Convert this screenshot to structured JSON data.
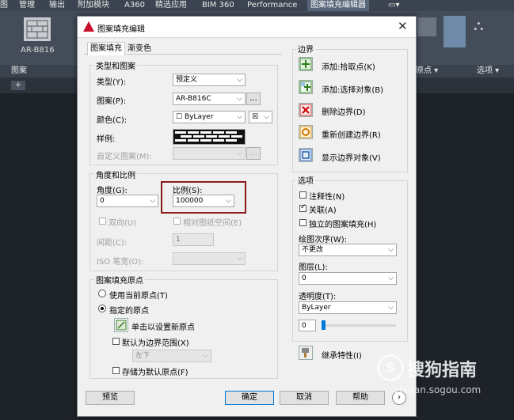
{
  "ribbon": {
    "menu": [
      "图",
      "管理",
      "输出",
      "附加模块",
      "A360",
      "精选应用",
      "BIM 360",
      "Performance",
      "图案填充编辑器"
    ],
    "pattern_label": "AR-B816",
    "panel_left": "图案",
    "panel_boundary_point": "原点",
    "panel_options": "选项"
  },
  "dialog": {
    "title": "图案填充编辑",
    "tabs": [
      "图案填充",
      "渐变色"
    ],
    "type_pattern": {
      "group": "类型和图案",
      "type_label": "类型(Y):",
      "type_value": "预定义",
      "pattern_label": "图案(P):",
      "pattern_value": "AR-B816C",
      "ellipsis": "...",
      "color_label": "颜色(C):",
      "color_value": "ByLayer",
      "swatch_label": "样例:",
      "custom_label": "自定义图案(M):"
    },
    "angle_scale": {
      "group": "角度和比例",
      "angle_label": "角度(G):",
      "angle_value": "0",
      "scale_label": "比例(S):",
      "scale_value": "100000",
      "double_label": "双向(U)",
      "relative_label": "相对图纸空间(E)",
      "spacing_label": "间距(C):",
      "spacing_value": "1",
      "iso_label": "ISO 笔宽(O):"
    },
    "origin": {
      "group": "图案填充原点",
      "use_current": "使用当前原点(T)",
      "specified": "指定的原点",
      "click_set": "单击以设置新原点",
      "default_boundary": "默认为边界范围(X)",
      "position_value": "左下",
      "store_default": "存储为默认原点(F)"
    },
    "boundary": {
      "group": "边界",
      "add_pick": "添加:拾取点(K)",
      "add_select": "添加:选择对象(B)",
      "remove": "删除边界(D)",
      "recreate": "重新创建边界(R)",
      "show": "显示边界对象(V)"
    },
    "options": {
      "group": "选项",
      "annotative": "注释性(N)",
      "associative": "关联(A)",
      "separate": "独立的图案填充(H)",
      "draw_order_label": "绘图次序(W):",
      "draw_order_value": "不更改",
      "layer_label": "图层(L):",
      "layer_value": "0",
      "transparency_label": "透明度(T):",
      "transparency_value": "ByLayer",
      "transparency_num": "0"
    },
    "inherit": "继承特性(I)",
    "buttons": {
      "preview": "预览",
      "ok": "确定",
      "cancel": "取消",
      "help": "帮助"
    }
  },
  "watermark": {
    "name": "搜狗指南",
    "url": "zhinan.sogou.com"
  },
  "colors": {
    "accent": "#0078d7",
    "highlight_box": "#8b1a1a"
  }
}
